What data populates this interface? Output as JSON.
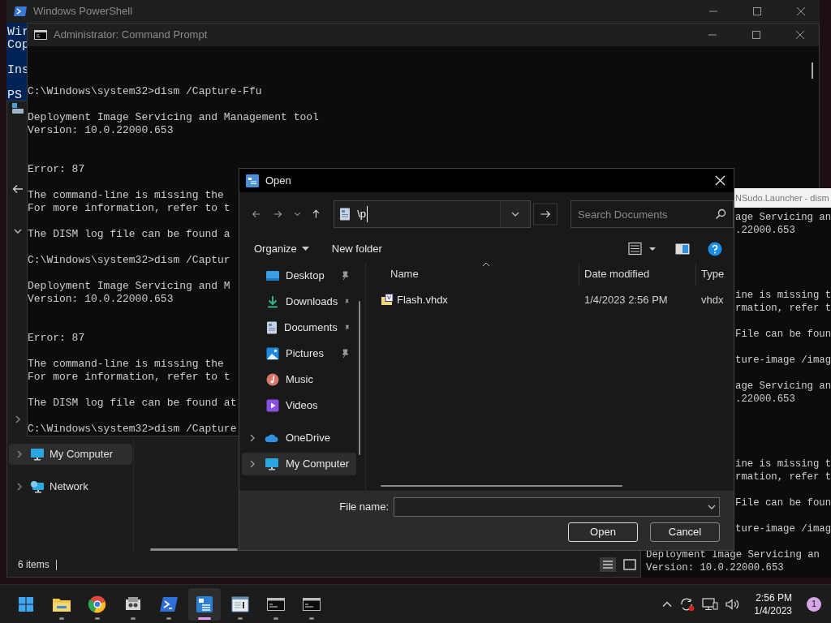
{
  "powershell": {
    "title": "Windows PowerShell",
    "blocks": [
      [
        "Wir",
        "Cop"
      ],
      [
        "Ins"
      ],
      [
        "PS"
      ]
    ]
  },
  "explorer": {
    "nav": [
      {
        "label": "My Computer",
        "selected": true
      },
      {
        "label": "Network",
        "selected": false
      }
    ],
    "status": "6 items"
  },
  "cmd": {
    "title": "Administrator: Command Prompt",
    "blocks": [
      {
        "kind": "command",
        "lines": [
          "C:\\Windows\\system32>dism /Capture-Ffu"
        ]
      },
      {
        "kind": "header",
        "lines": [
          "Deployment Image Servicing and Management tool",
          "Version: 10.0.22000.653"
        ]
      },
      {
        "kind": "error",
        "lines": [
          "Error: 87"
        ]
      },
      {
        "kind": "message",
        "lines": [
          "The command-line is missing the",
          "For more information, refer to t"
        ]
      },
      {
        "kind": "log",
        "lines": [
          "The DISM log file can be found a"
        ]
      },
      {
        "kind": "command",
        "lines": [
          "C:\\Windows\\system32>dism /Captur"
        ]
      },
      {
        "kind": "header",
        "lines": [
          "Deployment Image Servicing and M",
          "Version: 10.0.22000.653"
        ]
      },
      {
        "kind": "error",
        "lines": [
          "Error: 87"
        ]
      },
      {
        "kind": "message",
        "lines": [
          "The command-line is missing the",
          "For more information, refer to t"
        ]
      },
      {
        "kind": "log",
        "lines": [
          "The DISM log file can be found at"
        ]
      },
      {
        "kind": "command",
        "lines": [
          "C:\\Windows\\system32>dism /Capture"
        ]
      }
    ]
  },
  "nsudo": {
    "title": "NSudo.Launcher - dism",
    "blocks": [
      {
        "kind": "header",
        "lines": [
          "age Servicing an",
          ".22000.653"
        ]
      },
      {
        "kind": "message",
        "lines": [
          "ine is missing t",
          "rmation, refer t"
        ]
      },
      {
        "kind": "log",
        "lines": [
          "File can be foun"
        ]
      },
      {
        "kind": "command",
        "lines": [
          "ture-image /imag"
        ]
      },
      {
        "kind": "header",
        "lines": [
          "age Servicing an",
          ".22000.653"
        ]
      },
      {
        "kind": "message",
        "lines": [
          "ine is missing t",
          "rmation, refer t"
        ]
      },
      {
        "kind": "log",
        "lines": [
          "File can be foun"
        ]
      },
      {
        "kind": "command",
        "lines": [
          "ture-image /imag"
        ]
      }
    ],
    "bottom_lines": [
      "Deployment Image Servicing an",
      "Version: 10.0.22000.653"
    ]
  },
  "dialog": {
    "title": "Open",
    "address": "\\p",
    "search": {
      "placeholder": "Search Documents"
    },
    "commands": [
      "Organize",
      "New folder"
    ],
    "nav": [
      {
        "label": "Desktop",
        "pinned": true,
        "expandable": false,
        "selected": false
      },
      {
        "label": "Downloads",
        "pinned": true,
        "expandable": false,
        "selected": false
      },
      {
        "label": "Documents",
        "pinned": true,
        "expandable": false,
        "selected": false
      },
      {
        "label": "Pictures",
        "pinned": true,
        "expandable": false,
        "selected": false
      },
      {
        "label": "Music",
        "pinned": false,
        "expandable": false,
        "selected": false
      },
      {
        "label": "Videos",
        "pinned": false,
        "expandable": false,
        "selected": false
      },
      {
        "label": "OneDrive",
        "pinned": false,
        "expandable": true,
        "selected": false
      },
      {
        "label": "My Computer",
        "pinned": false,
        "expandable": true,
        "selected": true
      }
    ],
    "columns": [
      "Name",
      "Date modified",
      "Type"
    ],
    "files": [
      {
        "name": "Flash.vhdx",
        "date": "1/4/2023 2:56 PM",
        "type": "vhdx"
      }
    ],
    "file_name_label": "File name:",
    "buttons": [
      "Open",
      "Cancel"
    ]
  },
  "taskbar": {
    "apps": [
      {
        "kind": "start",
        "running": false,
        "active": false
      },
      {
        "kind": "folder",
        "running": true,
        "active": false
      },
      {
        "kind": "chrome",
        "running": true,
        "active": false
      },
      {
        "kind": "boxes",
        "running": true,
        "active": false
      },
      {
        "kind": "powershell",
        "running": true,
        "active": false
      },
      {
        "kind": "dialog",
        "running": true,
        "active": true
      },
      {
        "kind": "window",
        "running": true,
        "active": false
      },
      {
        "kind": "terminal",
        "running": true,
        "active": false
      },
      {
        "kind": "terminal",
        "running": true,
        "active": false
      }
    ],
    "clock": {
      "time": "2:56 PM",
      "date": "1/4/2023"
    },
    "notification_count": "1"
  }
}
